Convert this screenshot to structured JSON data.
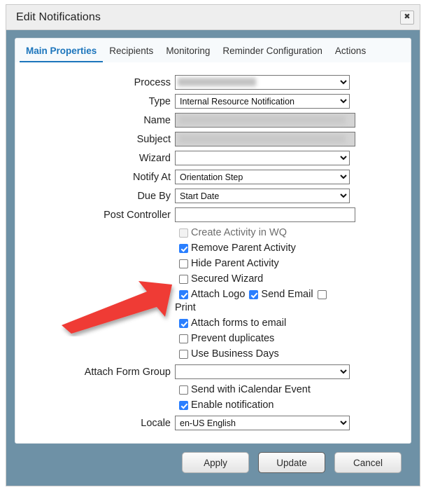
{
  "window": {
    "title": "Edit Notifications",
    "close_label": "✖"
  },
  "tabs": [
    {
      "label": "Main Properties",
      "active": true
    },
    {
      "label": "Recipients",
      "active": false
    },
    {
      "label": "Monitoring",
      "active": false
    },
    {
      "label": "Reminder Configuration",
      "active": false
    },
    {
      "label": "Actions",
      "active": false
    }
  ],
  "fields": {
    "process": {
      "label": "Process",
      "value": "",
      "redacted": true
    },
    "type": {
      "label": "Type",
      "value": "Internal Resource Notification"
    },
    "name": {
      "label": "Name",
      "value": "",
      "redacted": true
    },
    "subject": {
      "label": "Subject",
      "value": "",
      "redacted": true
    },
    "wizard": {
      "label": "Wizard",
      "value": ""
    },
    "notify_at": {
      "label": "Notify At",
      "value": "Orientation Step"
    },
    "due_by": {
      "label": "Due By",
      "value": "Start Date"
    },
    "post_controller": {
      "label": "Post Controller",
      "value": ""
    },
    "attach_form_group": {
      "label": "Attach Form Group",
      "value": ""
    },
    "locale": {
      "label": "Locale",
      "value": "en-US English"
    }
  },
  "checkboxes": {
    "create_activity_wq": {
      "label": "Create Activity in WQ",
      "checked": false,
      "disabled": true
    },
    "remove_parent_activity": {
      "label": "Remove Parent Activity",
      "checked": true
    },
    "hide_parent_activity": {
      "label": "Hide Parent Activity",
      "checked": false
    },
    "secured_wizard": {
      "label": "Secured Wizard",
      "checked": false
    },
    "attach_logo": {
      "label": "Attach Logo",
      "checked": true
    },
    "send_email": {
      "label": "Send Email",
      "checked": true
    },
    "print": {
      "label": "Print",
      "checked": false
    },
    "attach_forms_to_email": {
      "label": "Attach forms to email",
      "checked": true
    },
    "prevent_duplicates": {
      "label": "Prevent duplicates",
      "checked": false
    },
    "use_business_days": {
      "label": "Use Business Days",
      "checked": false
    },
    "send_with_icalendar": {
      "label": "Send with iCalendar Event",
      "checked": false
    },
    "enable_notification": {
      "label": "Enable notification",
      "checked": true
    }
  },
  "buttons": {
    "apply": "Apply",
    "update": "Update",
    "cancel": "Cancel"
  },
  "annotation": {
    "arrow_color": "#ef3b36",
    "points_to": "attach-logo-checkbox"
  },
  "colors": {
    "dialog_background": "#6e91a6",
    "titlebar": "#eeeeee",
    "active_tab": "#1c75bc",
    "checkbox_checked": "#2a7fff"
  }
}
